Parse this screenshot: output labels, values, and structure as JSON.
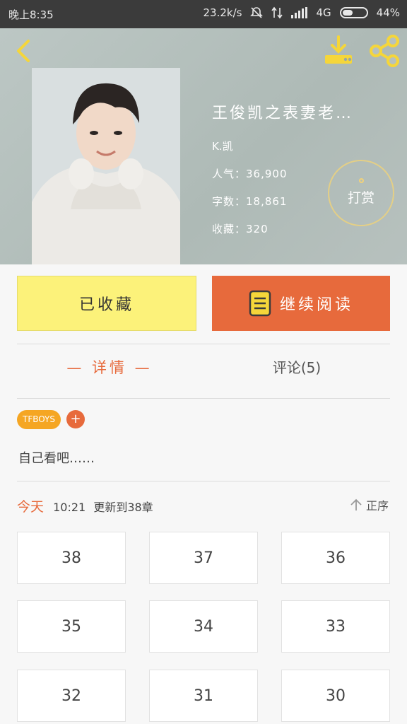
{
  "status_bar": {
    "time": "晚上8:35",
    "speed": "23.2k/s",
    "network": "4G",
    "battery": "44%",
    "battery_level": 0.44
  },
  "book": {
    "title": "王俊凯之表妻老…",
    "author": "K.凯",
    "popularity": "人气：36,900",
    "word_count": "字数：18,861",
    "favorites": "收藏：320",
    "tip_label": "打赏"
  },
  "actions": {
    "favorited_label": "已收藏",
    "continue_label": "继续阅读"
  },
  "tabs": {
    "detail": "— 详情 —",
    "comments": "评论(5)"
  },
  "tags": [
    "TFBOYS"
  ],
  "tag_add": "+",
  "description": "自己看吧……",
  "update": {
    "day": "今天",
    "time": "10:21",
    "text": "更新到38章",
    "sort_label": "正序"
  },
  "chapters": [
    "38",
    "37",
    "36",
    "35",
    "34",
    "33",
    "32",
    "31",
    "30"
  ],
  "colors": {
    "accent": "#e76a3c",
    "favorite_bg": "#fcf27a",
    "tag_bg": "#f5a623"
  }
}
